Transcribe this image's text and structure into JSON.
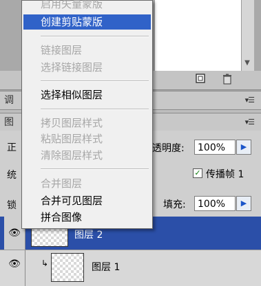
{
  "menu": {
    "items": [
      {
        "label": "启用矢量蒙版",
        "state": "disabled"
      },
      {
        "label": "创建剪贴蒙版",
        "state": "highlight"
      },
      {
        "label": "链接图层",
        "state": "disabled"
      },
      {
        "label": "选择链接图层",
        "state": "disabled"
      },
      {
        "label": "选择相似图层",
        "state": "enabled"
      },
      {
        "label": "拷贝图层样式",
        "state": "disabled"
      },
      {
        "label": "粘贴图层样式",
        "state": "disabled"
      },
      {
        "label": "清除图层样式",
        "state": "disabled"
      },
      {
        "label": "合并图层",
        "state": "disabled"
      },
      {
        "label": "合并可见图层",
        "state": "enabled"
      },
      {
        "label": "拼合图像",
        "state": "enabled"
      }
    ]
  },
  "panel_tabs": {
    "adjust_tab_partial": "调",
    "layers_tab_partial": "图"
  },
  "layers_panel": {
    "blend_mode_partial": "正",
    "opacity_label": "透明度:",
    "opacity_value": "100%",
    "unify_label_partial": "统",
    "propagate_label": "传播帧 1",
    "propagate_checked": true,
    "lock_label_partial": "锁",
    "fill_label": "填充:",
    "fill_value": "100%",
    "layers": [
      {
        "name": "图层 2",
        "selected": true,
        "visible": true
      },
      {
        "name": "图层 1",
        "selected": false,
        "visible": true,
        "clipped": true
      }
    ]
  },
  "icons": {
    "eye": "eye-icon",
    "new_layer": "new-layer-icon",
    "trash": "trash-icon",
    "panel_menu": "panel-menu-icon",
    "arrow_right": "arrow-right-icon",
    "scroll_down": "scroll-down-icon",
    "clip_arrow": "clip-arrow-icon"
  },
  "colors": {
    "highlight": "#3062c8",
    "selected_layer": "#2b4fa8",
    "disabled_text": "#a6a6a6",
    "menu_bg": "#f0f0f0"
  }
}
